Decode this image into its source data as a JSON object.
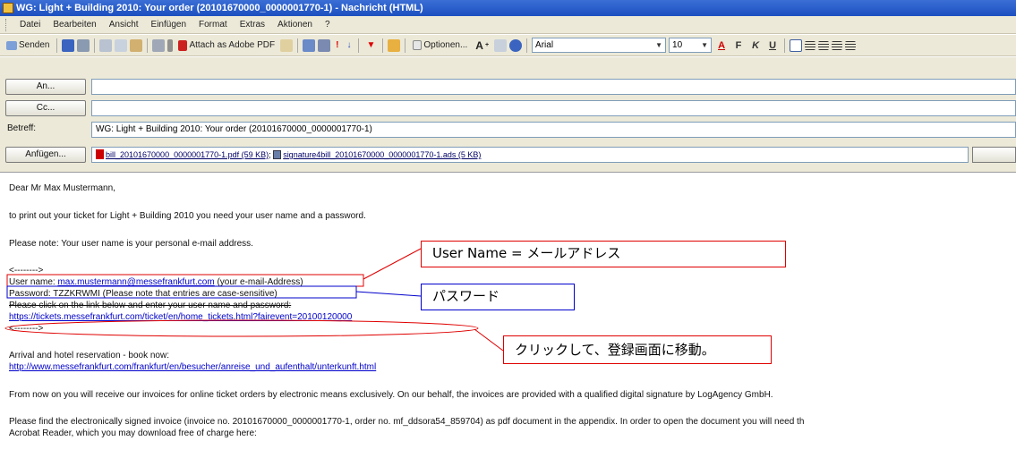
{
  "window": {
    "title": "WG: Light + Building 2010: Your order (20101670000_0000001770-1) - Nachricht (HTML)"
  },
  "menu": [
    "Datei",
    "Bearbeiten",
    "Ansicht",
    "Einfügen",
    "Format",
    "Extras",
    "Aktionen",
    "?"
  ],
  "toolbar": {
    "send_label": "Senden",
    "attach_pdf_label": "Attach as Adobe PDF",
    "options_label": "Optionen...",
    "font_name": "Arial",
    "font_size": "10",
    "format_buttons": [
      "A",
      "F",
      "K",
      "U"
    ]
  },
  "header": {
    "to_label": "An...",
    "to_value": "",
    "cc_label": "Cc...",
    "cc_value": "",
    "subject_label": "Betreff:",
    "subject_value": "WG: Light + Building 2010: Your order (20101670000_0000001770-1)",
    "attach_label": "Anfügen...",
    "attachment_1": "bill_20101670000_0000001770-1.pdf (59 KB)",
    "attachment_sep": ";",
    "attachment_2": "signature4bill_20101670000_0000001770-1.ads (5 KB)"
  },
  "body": {
    "greeting": "Dear Mr Max Mustermann,",
    "line1": "to print out your ticket for Light + Building 2010 you need your user name and a password.",
    "line2": "Please note: Your user name is your personal e-mail address.",
    "arrow1": "<-------->",
    "user_name_prefix": "User name: ",
    "user_name_email": "max.mustermann@messefrankfurt.com",
    "user_name_suffix": " (your e-mail-Address)",
    "password_line": "Password: TZZKRWMI (Please note that entries are case-sensitive)",
    "click_line": "Please click on the link below and enter your user name and password:",
    "ticket_link": "https://tickets.messefrankfurt.com/ticket/en/home_tickets.html?fairevent=20100120000",
    "arrow2": "<-------->",
    "arrival_line": "Arrival and hotel reservation - book now:",
    "arrival_link": "http://www.messefrankfurt.com/frankfurt/en/besucher/anreise_und_aufenthalt/unterkunft.html",
    "invoice_line": "From now on you will receive our invoices for online ticket orders by electronic means exclusively. On our behalf, the invoices are provided with a qualified digital signature by LogAgency GmbH.",
    "signed_line1": "Please find the electronically signed invoice (invoice no. 20101670000_0000001770-1, order no. mf_ddsora54_859704) as pdf document in the appendix. In order to open the document you will need th",
    "signed_line2": "Acrobat Reader, which you may download free of charge here:"
  },
  "callouts": {
    "username": "User Name = メールアドレス",
    "password": "パスワード",
    "click": "クリックして、登録画面に移動。"
  },
  "colors": {
    "red_annotation": "#e00000",
    "blue_annotation": "#0000cc"
  }
}
